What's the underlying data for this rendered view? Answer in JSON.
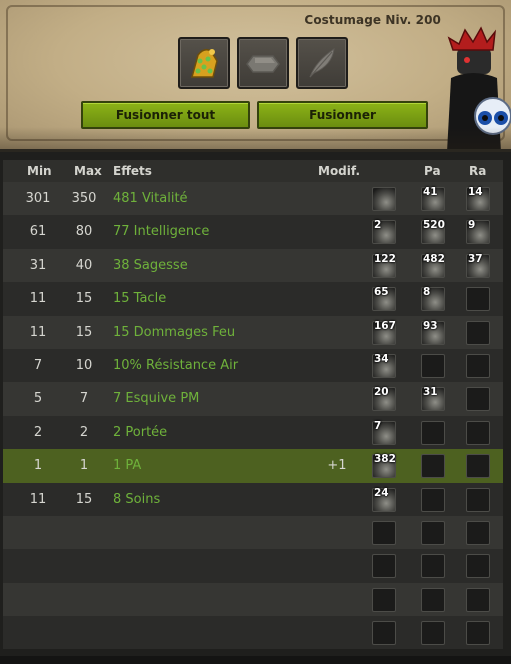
{
  "header": {
    "level_title": "Costumage Niv. 200",
    "slots": [
      {
        "icon": "golden-costume-item-icon"
      },
      {
        "icon": "rune-slot-icon"
      },
      {
        "icon": "feather-icon"
      }
    ],
    "buttons": {
      "merge_all": "Fusionner tout",
      "merge": "Fusionner"
    }
  },
  "table": {
    "columns": {
      "min": "Min",
      "max": "Max",
      "effects": "Effets",
      "modif": "Modif.",
      "pa": "Pa",
      "ra": "Ra"
    },
    "rows": [
      {
        "min": "301",
        "max": "350",
        "effect": "481 Vitalité",
        "modif": "",
        "rune": "41",
        "pa": "41",
        "ra": "14",
        "rune_mod": "",
        "selected": false
      },
      {
        "min": "61",
        "max": "80",
        "effect": "77 Intelligence",
        "modif": "",
        "rune_mod": "2",
        "pa": "520",
        "ra": "9",
        "selected": false
      },
      {
        "min": "31",
        "max": "40",
        "effect": "38 Sagesse",
        "modif": "",
        "rune_mod": "122",
        "pa": "482",
        "ra": "37",
        "selected": false
      },
      {
        "min": "11",
        "max": "15",
        "effect": "15 Tacle",
        "modif": "",
        "rune_mod": "65",
        "pa": "8",
        "ra": "",
        "selected": false
      },
      {
        "min": "11",
        "max": "15",
        "effect": "15 Dommages Feu",
        "modif": "",
        "rune_mod": "167",
        "pa": "93",
        "ra": "",
        "selected": false
      },
      {
        "min": "7",
        "max": "10",
        "effect": "10% Résistance Air",
        "modif": "",
        "rune_mod": "34",
        "pa": "",
        "ra": "",
        "selected": false
      },
      {
        "min": "5",
        "max": "7",
        "effect": "7 Esquive PM",
        "modif": "",
        "rune_mod": "20",
        "pa": "31",
        "ra": "",
        "selected": false
      },
      {
        "min": "2",
        "max": "2",
        "effect": "2 Portée",
        "modif": "",
        "rune_mod": "7",
        "pa": "",
        "ra": "",
        "selected": false
      },
      {
        "min": "1",
        "max": "1",
        "effect": "1 PA",
        "modif": "+1",
        "rune_mod": "382",
        "pa": "",
        "ra": "",
        "selected": true
      },
      {
        "min": "11",
        "max": "15",
        "effect": "8 Soins",
        "modif": "",
        "rune_mod": "24",
        "pa": "",
        "ra": "",
        "selected": false
      },
      {
        "min": "",
        "max": "",
        "effect": "",
        "modif": "",
        "rune_mod": "",
        "pa": "",
        "ra": "",
        "selected": false
      },
      {
        "min": "",
        "max": "",
        "effect": "",
        "modif": "",
        "rune_mod": "",
        "pa": "",
        "ra": "",
        "selected": false
      },
      {
        "min": "",
        "max": "",
        "effect": "",
        "modif": "",
        "rune_mod": "",
        "pa": "",
        "ra": "",
        "selected": false
      },
      {
        "min": "",
        "max": "",
        "effect": "",
        "modif": "",
        "rune_mod": "",
        "pa": "",
        "ra": "",
        "selected": false
      }
    ]
  },
  "colors": {
    "effect_text": "#6fb23b",
    "button_green": "#8cb317",
    "selected_row": "#4d6120"
  }
}
